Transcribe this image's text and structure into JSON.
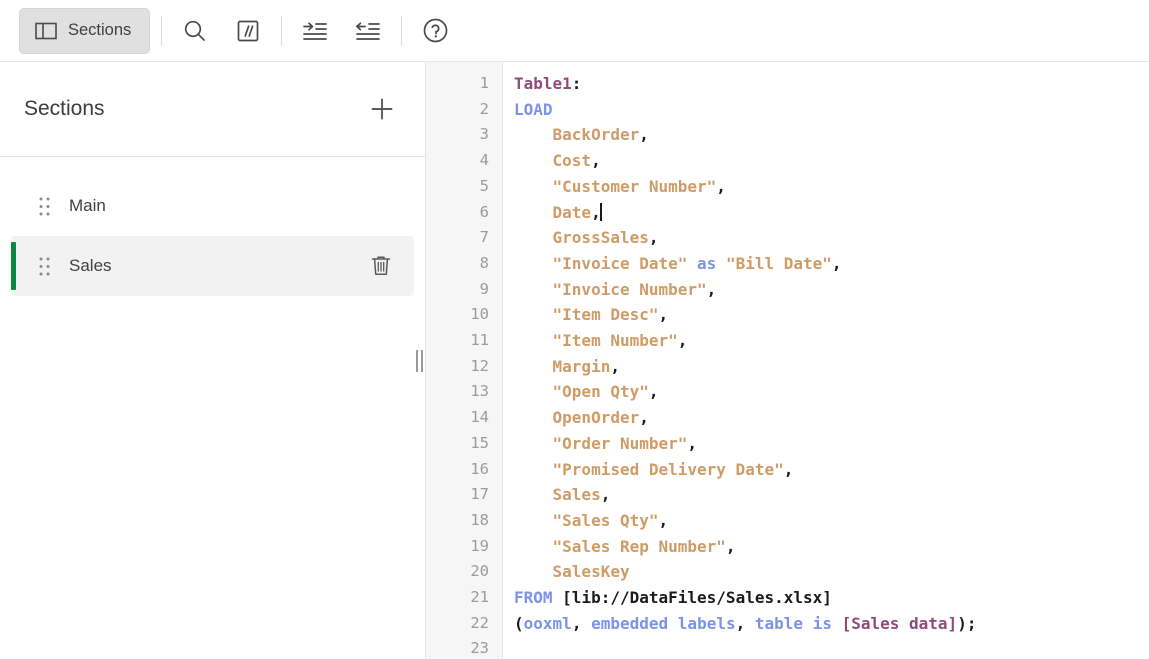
{
  "toolbar": {
    "sections_button": {
      "label": "Sections",
      "icon": "panel-layout-icon",
      "active": true
    },
    "buttons": [
      {
        "name": "search",
        "label": "Search",
        "icon": "search-icon"
      },
      {
        "name": "comment",
        "label": "Comment",
        "icon": "comment-slashes-icon"
      },
      {
        "name": "indent",
        "label": "Indent",
        "icon": "indent-increase-icon"
      },
      {
        "name": "outdent",
        "label": "Outdent",
        "icon": "indent-decrease-icon"
      },
      {
        "name": "help",
        "label": "Help",
        "icon": "help-circle-icon"
      }
    ]
  },
  "sidebar": {
    "title": "Sections",
    "add_label": "+",
    "add_icon": "plus-icon",
    "items": [
      {
        "label": "Main",
        "active": false,
        "drag_icon": "drag-dots-icon"
      },
      {
        "label": "Sales",
        "active": true,
        "drag_icon": "drag-dots-icon",
        "delete_icon": "trash-icon"
      }
    ]
  },
  "splitter": {
    "icon": "resize-grip-icon"
  },
  "editor": {
    "line_numbers": [
      "1",
      "2",
      "3",
      "4",
      "5",
      "6",
      "7",
      "8",
      "9",
      "10",
      "11",
      "12",
      "13",
      "14",
      "15",
      "16",
      "17",
      "18",
      "19",
      "20",
      "21",
      "22",
      "23"
    ],
    "cursor": {
      "line": 6,
      "column": 9
    },
    "lines": [
      {
        "n": 1,
        "text": "Table1:"
      },
      {
        "n": 2,
        "text": "LOAD"
      },
      {
        "n": 3,
        "text": "    BackOrder,"
      },
      {
        "n": 4,
        "text": "    Cost,"
      },
      {
        "n": 5,
        "text": "    \"Customer Number\","
      },
      {
        "n": 6,
        "text": "    Date,"
      },
      {
        "n": 7,
        "text": "    GrossSales,"
      },
      {
        "n": 8,
        "text": "    \"Invoice Date\" as \"Bill Date\","
      },
      {
        "n": 9,
        "text": "    \"Invoice Number\","
      },
      {
        "n": 10,
        "text": "    \"Item Desc\","
      },
      {
        "n": 11,
        "text": "    \"Item Number\","
      },
      {
        "n": 12,
        "text": "    Margin,"
      },
      {
        "n": 13,
        "text": "    \"Open Qty\","
      },
      {
        "n": 14,
        "text": "    OpenOrder,"
      },
      {
        "n": 15,
        "text": "    \"Order Number\","
      },
      {
        "n": 16,
        "text": "    \"Promised Delivery Date\","
      },
      {
        "n": 17,
        "text": "    Sales,"
      },
      {
        "n": 18,
        "text": "    \"Sales Qty\","
      },
      {
        "n": 19,
        "text": "    \"Sales Rep Number\","
      },
      {
        "n": 20,
        "text": "    SalesKey"
      },
      {
        "n": 21,
        "text": "FROM [lib://DataFiles/Sales.xlsx]"
      },
      {
        "n": 22,
        "text": "(ooxml, embedded labels, table is [Sales data]);"
      },
      {
        "n": 23,
        "text": ""
      }
    ]
  },
  "colors": {
    "accent_green": "#0a8a3e",
    "keyword_blue": "#7b93e8",
    "field_tan": "#cf9b66",
    "table_purple": "#8e4b7a",
    "punct_dark": "#1a1a1a",
    "gutter_bg": "#f6f6f6",
    "selected_row_bg": "#f2f2f2"
  }
}
